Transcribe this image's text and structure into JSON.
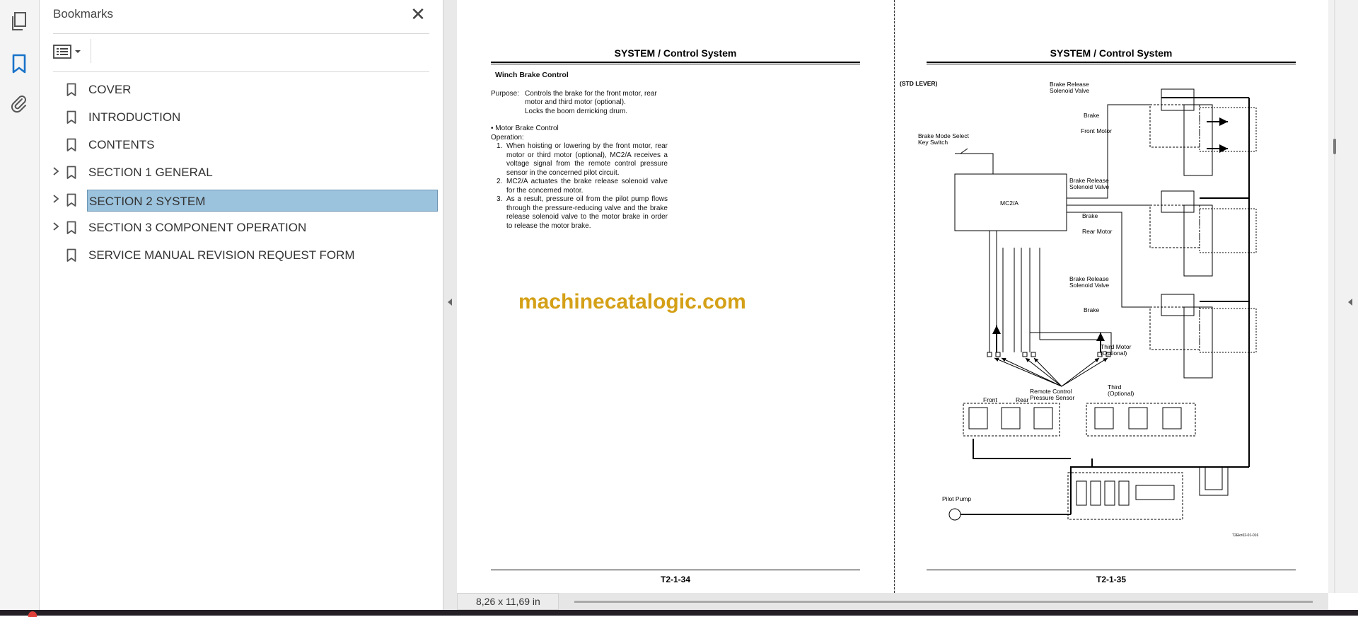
{
  "sidebar_rail": {
    "icons": [
      "pages-icon",
      "bookmark-icon",
      "attachment-icon"
    ]
  },
  "bookmarks": {
    "title": "Bookmarks",
    "close_glyph": "✕",
    "items": [
      {
        "label": "COVER",
        "expandable": false,
        "selected": false
      },
      {
        "label": "INTRODUCTION",
        "expandable": false,
        "selected": false
      },
      {
        "label": "CONTENTS",
        "expandable": false,
        "selected": false
      },
      {
        "label": "SECTION 1 GENERAL",
        "expandable": true,
        "selected": false
      },
      {
        "label": "SECTION 2 SYSTEM",
        "expandable": true,
        "selected": true
      },
      {
        "label": "SECTION 3 COMPONENT OPERATION",
        "expandable": true,
        "selected": false
      },
      {
        "label": "SERVICE MANUAL REVISION REQUEST FORM",
        "expandable": false,
        "selected": false
      }
    ]
  },
  "page_left": {
    "header": "SYSTEM / Control System",
    "section_title": "Winch Brake Control",
    "purpose_label": "Purpose:",
    "purpose_lines": [
      "Controls the brake for the front motor, rear",
      "motor and third motor (optional).",
      "Locks the boom derricking drum."
    ],
    "bullet": "• Motor Brake Control",
    "operation_label": "Operation:",
    "steps": [
      "When hoisting or lowering by the front motor, rear motor or third motor (optional), MC2/A receives a voltage signal from the remote control pressure sensor in the concerned pilot circuit.",
      "MC2/A actuates the brake release solenoid valve for the concerned motor.",
      "As a result, pressure oil from the pilot pump flows through the pressure-reducing valve and the brake release solenoid valve to the motor brake in order to release the motor brake."
    ],
    "footer": "T2-1-34"
  },
  "watermark": "machinecatalogic.com",
  "page_right": {
    "header": "SYSTEM / Control System",
    "footer": "T2-1-35",
    "diagram_labels": {
      "std_lever": "(STD LEVER)",
      "key_switch_1": "Brake Mode Select",
      "key_switch_2": "Key Switch",
      "controller": "MC2/A",
      "brs1_a": "Brake Release",
      "brs1_b": "Solenoid Valve",
      "brake1": "Brake",
      "front_motor": "Front Motor",
      "brs2_a": "Brake Release",
      "brs2_b": "Solenoid Valve",
      "brake2": "Brake",
      "rear_motor": "Rear Motor",
      "brs3_a": "Brake Release",
      "brs3_b": "Solenoid Valve",
      "brake3": "Brake",
      "third_motor_a": "Third Motor",
      "third_motor_b": "(Optional)",
      "front": "Front",
      "rear": "Rear",
      "rcps_a": "Remote Control",
      "rcps_b": "Pressure Sensor",
      "third_a": "Third",
      "third_b": "(Optional)",
      "pilot_pump": "Pilot Pump",
      "fig_code": "T2Ekn02-01-016"
    }
  },
  "status": {
    "page_size": "8,26 x 11,69 in"
  }
}
